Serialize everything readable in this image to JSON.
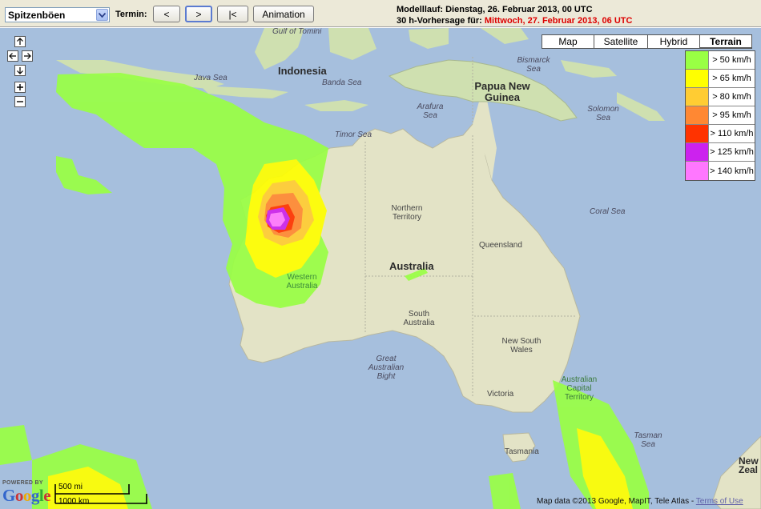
{
  "toolbar": {
    "parameter": "Spitzenböen",
    "termin_label": "Termin:",
    "prev_label": "<",
    "next_label": ">",
    "first_label": "|<",
    "animation_label": "Animation"
  },
  "model_info": {
    "run_label": "Modelllauf: Dienstag, 26. Februar 2013, 00 UTC",
    "forecast_prefix": "30 h-Vorhersage für:",
    "forecast_date": "Mittwoch, 27. Februar 2013, 06 UTC",
    "forecast_color": "#dd0000"
  },
  "map_types": [
    {
      "label": "Map",
      "active": false
    },
    {
      "label": "Satellite",
      "active": false
    },
    {
      "label": "Hybrid",
      "active": false
    },
    {
      "label": "Terrain",
      "active": true
    }
  ],
  "legend": [
    {
      "color": "#99ff44",
      "label": "> 50 km/h"
    },
    {
      "color": "#ffff00",
      "label": "> 65 km/h"
    },
    {
      "color": "#ffcc33",
      "label": "> 80 km/h"
    },
    {
      "color": "#ff8833",
      "label": "> 95 km/h"
    },
    {
      "color": "#ff3300",
      "label": "> 110 km/h"
    },
    {
      "color": "#cc22ee",
      "label": "> 125 km/h"
    },
    {
      "color": "#ff77ff",
      "label": "> 140 km/h"
    }
  ],
  "map_labels": {
    "gulf_tomini": "Gulf of Tomini",
    "indonesia": "Indonesia",
    "java_sea": "Java Sea",
    "banda_sea": "Banda Sea",
    "bismarck_sea": "Bismarck Sea",
    "png": "Papua New Guinea",
    "arafura_sea": "Arafura Sea",
    "solomon_sea": "Solomon Sea",
    "timor_sea": "Timor Sea",
    "coral_sea": "Coral Sea",
    "northern_territory": "Northern Territory",
    "queensland": "Queensland",
    "australia": "Australia",
    "western_australia": "Western Australia",
    "south_australia": "South Australia",
    "new_south_wales": "New South Wales",
    "great_australian_bight": "Great Australian Bight",
    "victoria": "Victoria",
    "act": "Australian Capital Territory",
    "tasman_sea": "Tasman Sea",
    "tasmania": "Tasmania",
    "new_zealand": "New Zeal"
  },
  "controls": {
    "up": "↑",
    "left": "←",
    "right": "→",
    "down": "↓",
    "zoom_in": "+",
    "zoom_out": "−"
  },
  "branding": {
    "powered_by": "POWERED BY",
    "google": "Google"
  },
  "scale": {
    "miles": "500 mi",
    "km": "1000 km"
  },
  "attribution": {
    "text": "Map data ©2013 Google, MapIT, Tele Atlas - ",
    "terms": "Terms of Use"
  },
  "colors": {
    "ocean": "#a6bfdd",
    "land": "#e6e6cc",
    "green_land": "#cfe0b0"
  }
}
